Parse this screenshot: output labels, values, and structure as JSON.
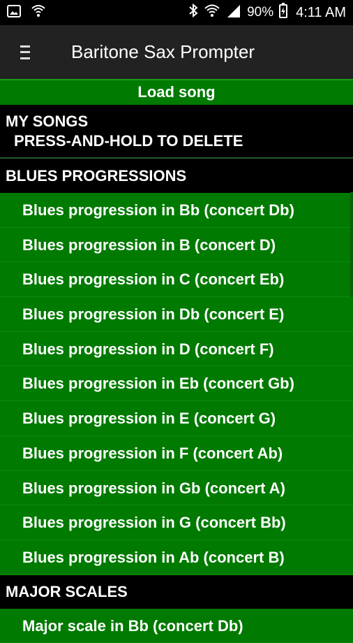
{
  "status_bar": {
    "battery": "90%",
    "time": "4:11 AM",
    "icons": [
      "image-icon",
      "shield-icon",
      "bluetooth-icon",
      "wifi-icon",
      "signal-icon",
      "battery-charging-icon"
    ]
  },
  "app_bar": {
    "title": "Baritone Sax Prompter",
    "menu_icon": "hamburger-menu-icon"
  },
  "load_song_label": "Load song",
  "sections": {
    "my_songs": {
      "title": "MY SONGS",
      "subtitle": "PRESS-AND-HOLD TO DELETE"
    },
    "blues": {
      "title": "BLUES PROGRESSIONS",
      "items": [
        "Blues progression in Bb (concert Db)",
        "Blues progression in B (concert D)",
        "Blues progression in C (concert Eb)",
        "Blues progression in Db (concert E)",
        "Blues progression in D (concert F)",
        "Blues progression in Eb (concert Gb)",
        "Blues progression in E (concert G)",
        "Blues progression in F (concert Ab)",
        "Blues progression in Gb (concert A)",
        "Blues progression in G (concert Bb)",
        "Blues progression in Ab (concert B)"
      ]
    },
    "major": {
      "title": "MAJOR SCALES",
      "items": [
        "Major scale in Bb (concert Db)"
      ]
    }
  },
  "colors": {
    "item_bg": "#007a00",
    "header_bg": "#000000",
    "app_bar_bg": "#222222"
  }
}
